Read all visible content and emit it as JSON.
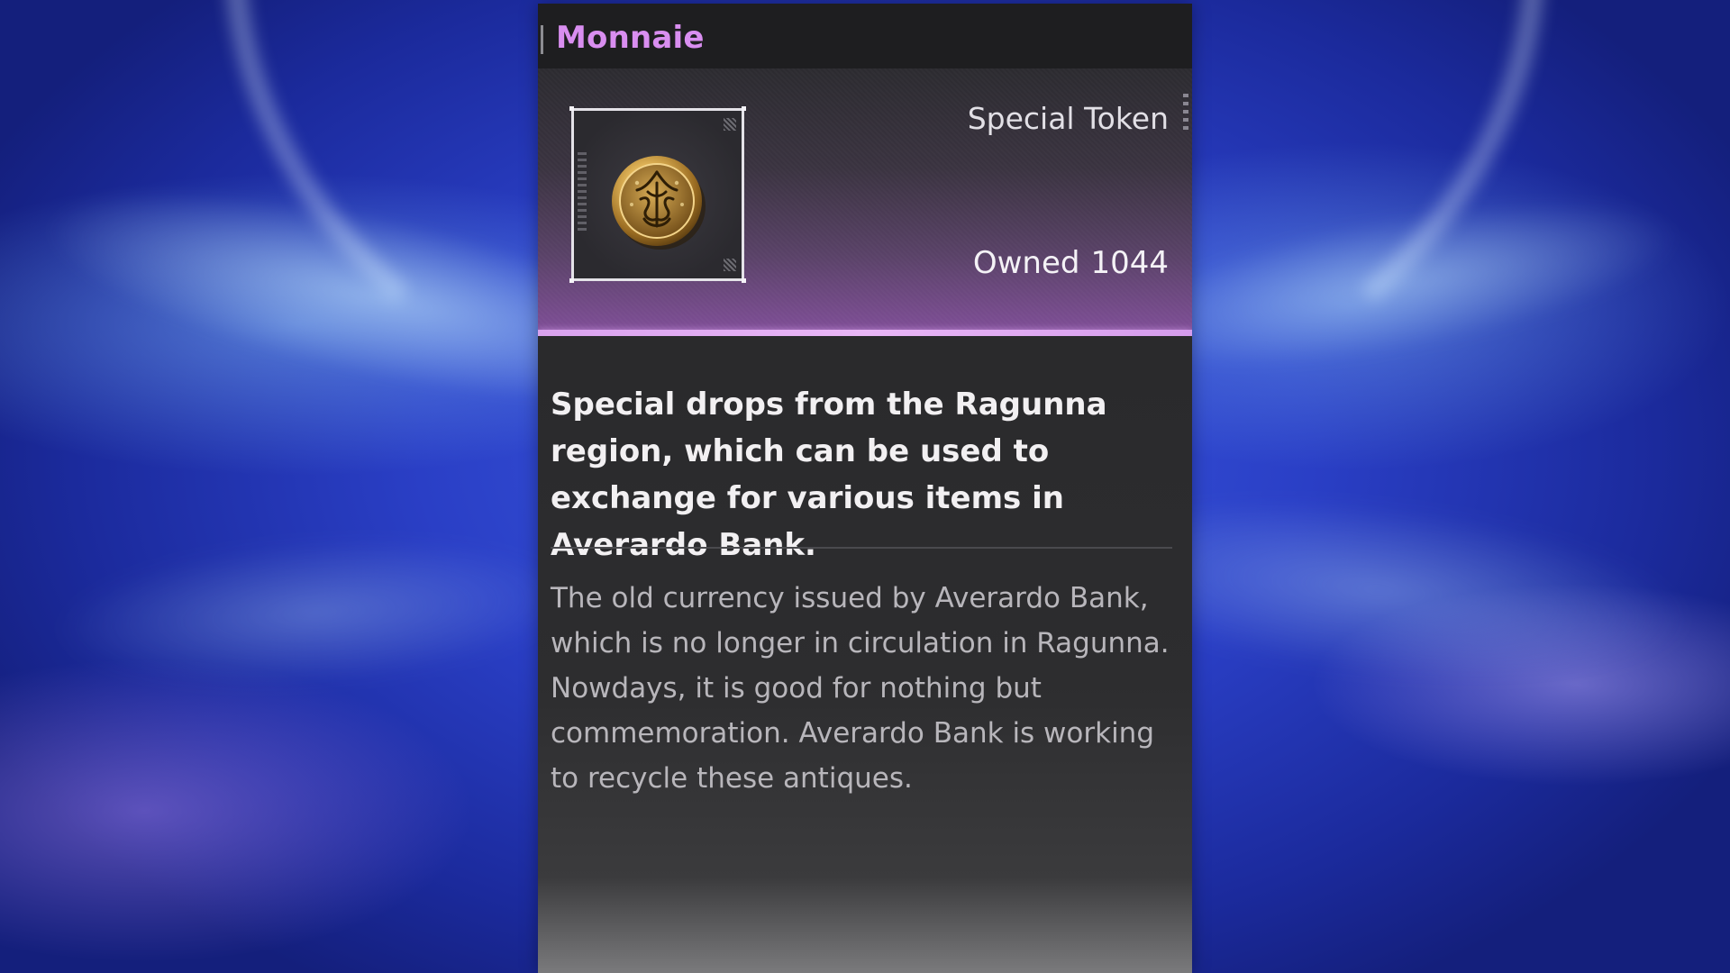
{
  "panel": {
    "title": "Monnaie",
    "item_type": "Special Token",
    "owned_label": "Owned",
    "owned_count": "1044",
    "icon": "gold-coin-icon",
    "effect": "Special drops from the Ragunna region, which can be used to exchange for various items in Averardo Bank.",
    "lore": [
      "The old currency issued by Averardo Bank, which is no longer in circulation in Ragunna.",
      "Nowdays, it is good for nothing but commemoration. Averardo Bank is working to recycle these antiques."
    ]
  },
  "colors": {
    "title": "#d98ef0",
    "accent": "#e9b6f6",
    "panel_bg": "#2a2a2c",
    "background": "#2a3fc6"
  }
}
